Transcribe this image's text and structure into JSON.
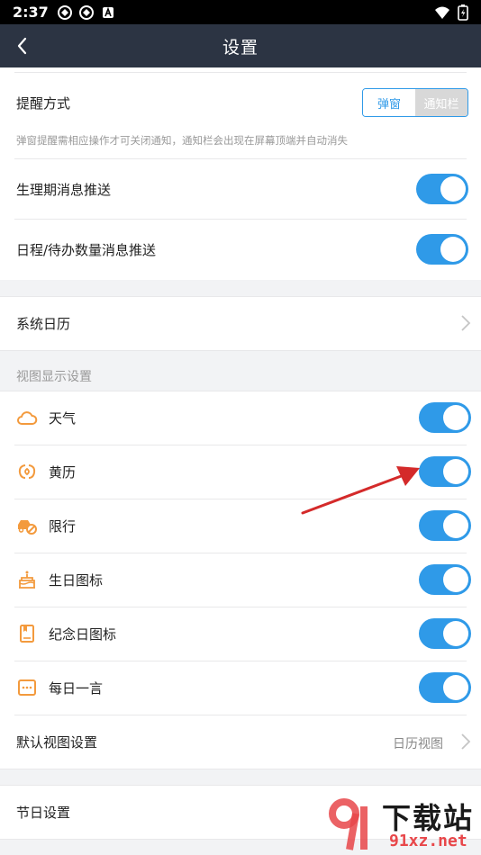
{
  "status_bar": {
    "time": "2:37"
  },
  "app_bar": {
    "title": "设置"
  },
  "reminder": {
    "label": "提醒方式",
    "options": [
      "弹窗",
      "通知栏"
    ],
    "selected": "弹窗",
    "hint": "弹窗提醒需相应操作才可关闭通知，通知栏会出现在屏幕顶端并自动消失"
  },
  "push": [
    {
      "label": "生理期消息推送",
      "on": true
    },
    {
      "label": "日程/待办数量消息推送",
      "on": true
    }
  ],
  "system_calendar": {
    "label": "系统日历"
  },
  "view_settings": {
    "header": "视图显示设置",
    "items": [
      {
        "label": "天气",
        "icon": "cloud-icon",
        "on": true
      },
      {
        "label": "黄历",
        "icon": "almanac-icon",
        "on": true
      },
      {
        "label": "限行",
        "icon": "car-restriction-icon",
        "on": true
      },
      {
        "label": "生日图标",
        "icon": "cake-icon",
        "on": true
      },
      {
        "label": "纪念日图标",
        "icon": "book-icon",
        "on": true
      },
      {
        "label": "每日一言",
        "icon": "message-icon",
        "on": true
      }
    ],
    "default_view": {
      "label": "默认视图设置",
      "value": "日历视图"
    }
  },
  "holiday": {
    "label": "节日设置"
  },
  "watermark": {
    "text": "下载站",
    "url_text": "91xz.net"
  },
  "colors": {
    "accent": "#2f9ae8",
    "icon_orange": "#f39a3d",
    "appbar": "#2c3443",
    "arrow": "#d42a2a"
  }
}
